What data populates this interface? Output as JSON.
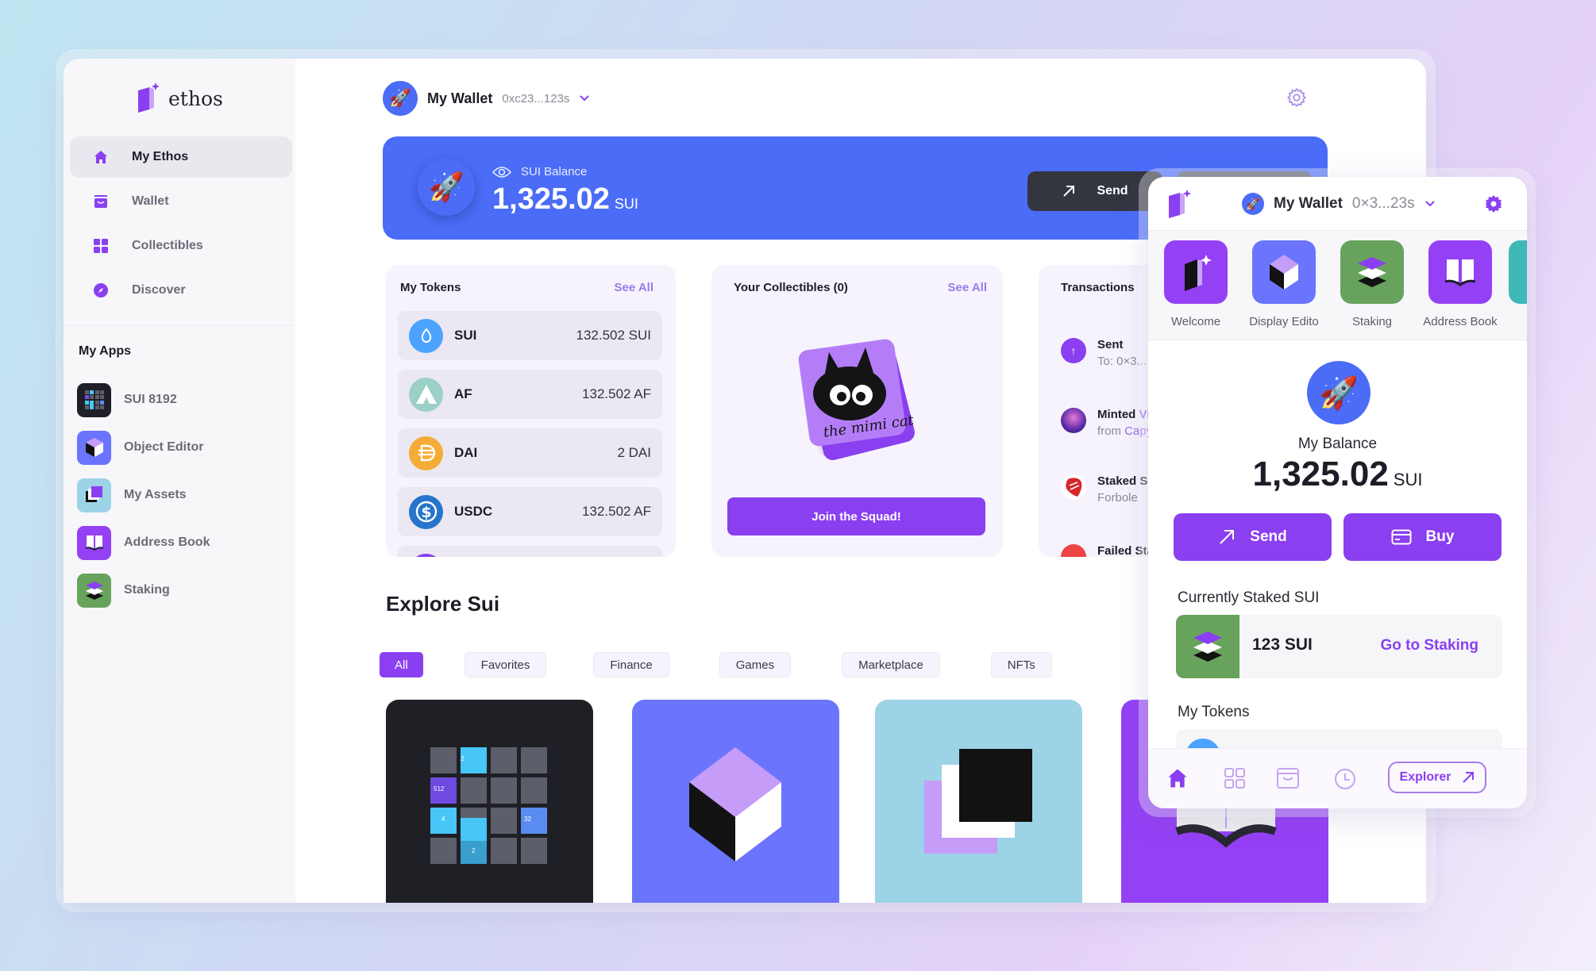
{
  "brand": {
    "name": "ethos"
  },
  "sidebar": {
    "nav": [
      {
        "label": "My Ethos",
        "icon": "home-icon",
        "active": true
      },
      {
        "label": "Wallet",
        "icon": "wallet-icon"
      },
      {
        "label": "Collectibles",
        "icon": "grid-icon"
      },
      {
        "label": "Discover",
        "icon": "compass-icon"
      }
    ],
    "apps_title": "My Apps",
    "apps": [
      {
        "label": "SUI 8192"
      },
      {
        "label": "Object Editor"
      },
      {
        "label": "My Assets"
      },
      {
        "label": "Address Book"
      },
      {
        "label": "Staking"
      }
    ]
  },
  "header": {
    "wallet_name": "My Wallet",
    "wallet_address": "0xc23...123s"
  },
  "balance": {
    "label": "SUI Balance",
    "value": "1,325.02",
    "unit": "SUI",
    "send_label": "Send"
  },
  "tokens": {
    "title": "My Tokens",
    "see_all": "See All",
    "items": [
      {
        "symbol": "SUI",
        "amount": "132.502 SUI",
        "color": "#4da2ff"
      },
      {
        "symbol": "AF",
        "amount": "132.502 AF",
        "color": "#9ccfc6"
      },
      {
        "symbol": "DAI",
        "amount": "2 DAI",
        "color": "#f5ac37"
      },
      {
        "symbol": "USDC",
        "amount": "132.502 AF",
        "color": "#2775ca"
      }
    ]
  },
  "collectibles": {
    "title": "Your Collectibles (0)",
    "see_all": "See All",
    "cta": "Join the Squad!"
  },
  "transactions": {
    "title": "Transactions",
    "items": [
      {
        "title": "Sent",
        "sub": "To: 0×3..."
      },
      {
        "title": "Minted ",
        "title_accent": "Vi",
        "sub": "from ",
        "sub_accent": "Capy"
      },
      {
        "title": "Staked SU",
        "sub": "Forbole"
      },
      {
        "title": "Failed Sta",
        "sub": ""
      }
    ]
  },
  "explore": {
    "title": "Explore Sui",
    "chips": [
      "All",
      "Favorites",
      "Finance",
      "Games",
      "Marketplace",
      "NFTs"
    ],
    "active_chip": "All",
    "game_tiles": [
      "2",
      "512",
      "4",
      "32",
      "2"
    ]
  },
  "popup": {
    "wallet_name": "My Wallet",
    "wallet_address": "0×3...23s",
    "apps": [
      {
        "label": "Welcome"
      },
      {
        "label": "Display Edito"
      },
      {
        "label": "Staking"
      },
      {
        "label": "Address Book"
      }
    ],
    "balance_label": "My Balance",
    "balance_value": "1,325.02",
    "balance_unit": "SUI",
    "send_label": "Send",
    "buy_label": "Buy",
    "staked_label": "Currently Staked SUI",
    "staked_amount": "123 SUI",
    "staked_link": "Go to Staking",
    "tokens_label": "My Tokens",
    "explorer_label": "Explorer"
  },
  "colors": {
    "accent": "#8a3ff0",
    "blue": "#4a6cf7",
    "green": "#68a35d"
  }
}
